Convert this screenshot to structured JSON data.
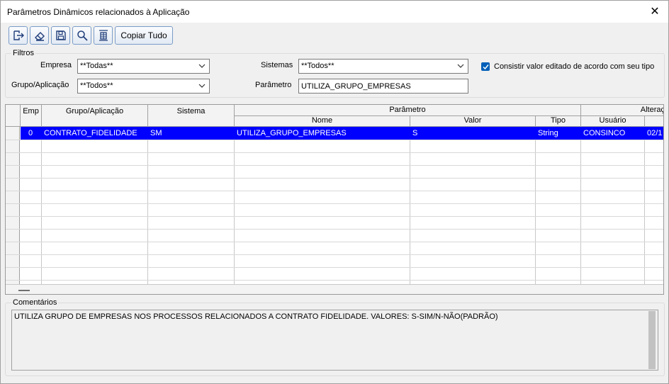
{
  "window": {
    "title": "Parâmetros Dinâmicos relacionados à Aplicação",
    "close_glyph": "✕"
  },
  "toolbar": {
    "buttons": [
      {
        "icon": "exit-icon"
      },
      {
        "icon": "eraser-icon"
      },
      {
        "icon": "save-icon"
      },
      {
        "icon": "search-icon"
      },
      {
        "icon": "table-icon"
      }
    ],
    "copy_label": "Copiar Tudo"
  },
  "filters": {
    "legend": "Filtros",
    "empresa_label": "Empresa",
    "empresa_value": "**Todas**",
    "grupo_label": "Grupo/Aplicação",
    "grupo_value": "**Todos**",
    "sistemas_label": "Sistemas",
    "sistemas_value": "**Todos**",
    "parametro_label": "Parâmetro",
    "parametro_value": "UTILIZA_GRUPO_EMPRESAS",
    "consistir_label": "Consistir valor editado de acordo com seu tipo",
    "consistir_checked": true
  },
  "grid": {
    "headers": {
      "emp": "Emp",
      "grupo": "Grupo/Aplicação",
      "sistema": "Sistema",
      "parametro": "Parâmetro",
      "nome": "Nome",
      "valor": "Valor",
      "tipo": "Tipo",
      "alteracao": "Alteraç",
      "usuario": "Usuário"
    },
    "rows": [
      {
        "emp": "0",
        "grupo": "CONTRATO_FIDELIDADE",
        "sistema": "SM",
        "nome": "UTILIZA_GRUPO_EMPRESAS",
        "valor": "S",
        "tipo": "String",
        "usuario": "CONSINCO",
        "data": "02/1"
      }
    ],
    "selected_color": "#0000ff"
  },
  "comments": {
    "legend": "Comentários",
    "text": "UTILIZA GRUPO DE EMPRESAS NOS PROCESSOS RELACIONADOS A CONTRATO FIDELIDADE. VALORES: S-SIM/N-NÃO(PADRÃO)"
  }
}
